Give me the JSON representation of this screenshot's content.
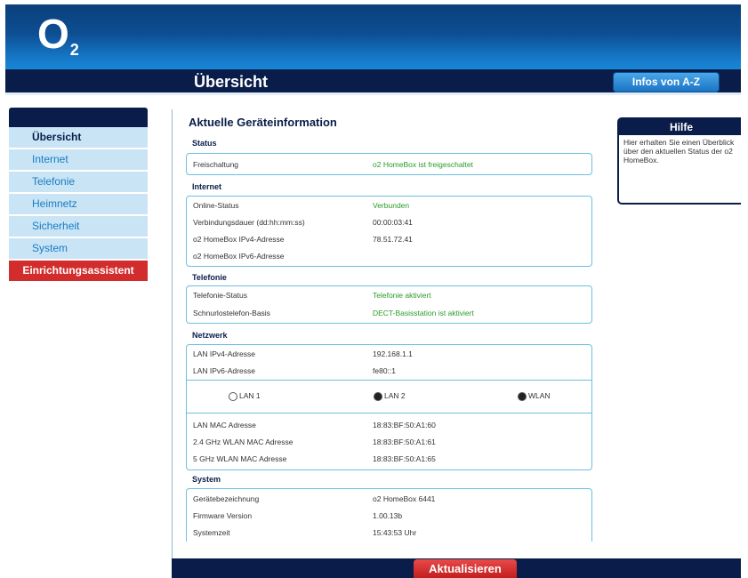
{
  "header": {
    "logo": "O",
    "logo_sub": "2",
    "title": "Übersicht",
    "infos_button": "Infos von A-Z"
  },
  "sidebar": {
    "items": [
      {
        "label": "Übersicht"
      },
      {
        "label": "Internet"
      },
      {
        "label": "Telefonie"
      },
      {
        "label": "Heimnetz"
      },
      {
        "label": "Sicherheit"
      },
      {
        "label": "System"
      }
    ],
    "wizard": "Einrichtungsassistent"
  },
  "main": {
    "title": "Aktuelle Geräteinformation",
    "status": {
      "label": "Status",
      "rows": [
        {
          "key": "Freischaltung",
          "value": "o2 HomeBox ist freigeschaltet"
        }
      ]
    },
    "internet": {
      "label": "Internet",
      "rows": [
        {
          "key": "Online-Status",
          "value": "Verbunden"
        },
        {
          "key": "Verbindungsdauer (dd:hh:mm:ss)",
          "value": "00:00:03:41"
        },
        {
          "key": "o2 HomeBox IPv4-Adresse",
          "value": "78.51.72.41"
        },
        {
          "key": "o2 HomeBox IPv6-Adresse",
          "value": ""
        }
      ]
    },
    "telefonie": {
      "label": "Telefonie",
      "rows": [
        {
          "key": "Telefonie-Status",
          "value": "Telefonie aktiviert"
        },
        {
          "key": "Schnurlostelefon-Basis",
          "value": "DECT-Basisstation ist aktiviert"
        }
      ]
    },
    "netzwerk": {
      "label": "Netzwerk",
      "rows_top": [
        {
          "key": "LAN IPv4-Adresse",
          "value": "192.168.1.1"
        },
        {
          "key": "LAN IPv6-Adresse",
          "value": "fe80::1"
        }
      ],
      "radios": [
        {
          "label": "LAN 1",
          "selected": false
        },
        {
          "label": "LAN 2",
          "selected": true
        },
        {
          "label": "WLAN",
          "selected": true
        }
      ],
      "rows_bottom": [
        {
          "key": "LAN MAC Adresse",
          "value": "18:83:BF:50:A1:60"
        },
        {
          "key": "2.4 GHz WLAN MAC Adresse",
          "value": "18:83:BF:50:A1:61"
        },
        {
          "key": "5 GHz WLAN MAC Adresse",
          "value": "18:83:BF:50:A1:65"
        }
      ]
    },
    "system": {
      "label": "System",
      "rows": [
        {
          "key": "Gerätebezeichnung",
          "value": "o2 HomeBox 6441"
        },
        {
          "key": "Firmware Version",
          "value": "1.00.13b"
        },
        {
          "key": "Systemzeit",
          "value": "15:43:53 Uhr"
        }
      ]
    }
  },
  "help": {
    "title": "Hilfe",
    "text": "Hier erhalten Sie einen Überblick über den aktuellen Status der o2 HomeBox."
  },
  "footer": {
    "refresh_button": "Aktualisieren"
  }
}
